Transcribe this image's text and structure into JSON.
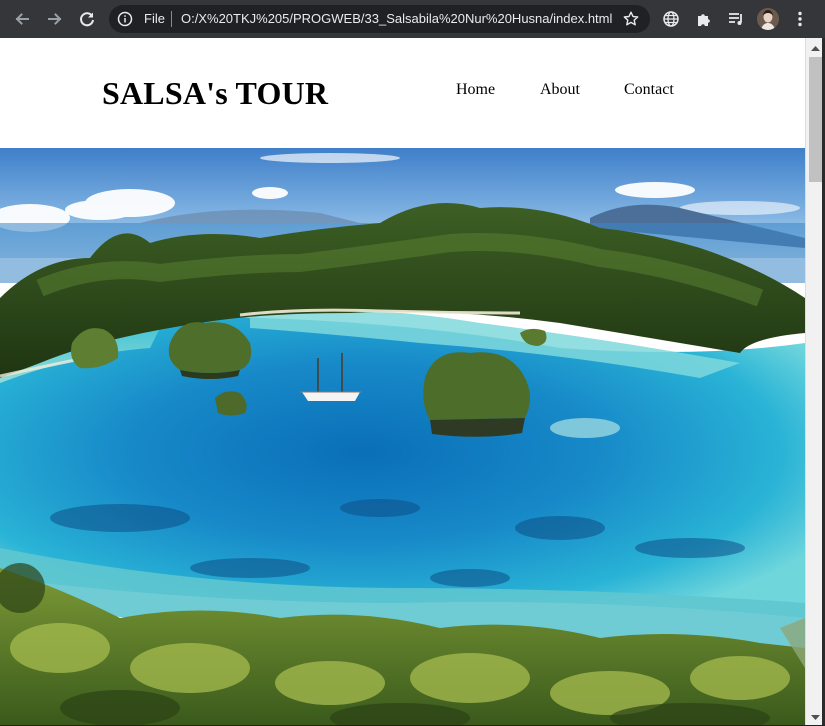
{
  "browser": {
    "omnibox": {
      "scheme_label": "File",
      "url": "O:/X%20TKJ%205/PROGWEB/33_Salsabila%20Nur%20Husna/index.html"
    },
    "icons": {
      "back": "back-arrow-icon",
      "forward": "forward-arrow-icon",
      "reload": "reload-icon",
      "info": "info-icon",
      "bookmark": "star-icon",
      "globe": "globe-icon",
      "extensions": "puzzle-icon",
      "media": "media-queue-icon",
      "profile": "avatar",
      "menu": "kebab-menu-icon"
    },
    "colors": {
      "toolbar": "#35363a",
      "omnibox": "#202124",
      "icon": "#e8eaed"
    }
  },
  "site": {
    "logo": "SALSA's TOUR",
    "nav": [
      {
        "label": "Home"
      },
      {
        "label": "About"
      },
      {
        "label": "Contact"
      }
    ],
    "hero_image": "tropical-lagoon-islands-photo"
  }
}
